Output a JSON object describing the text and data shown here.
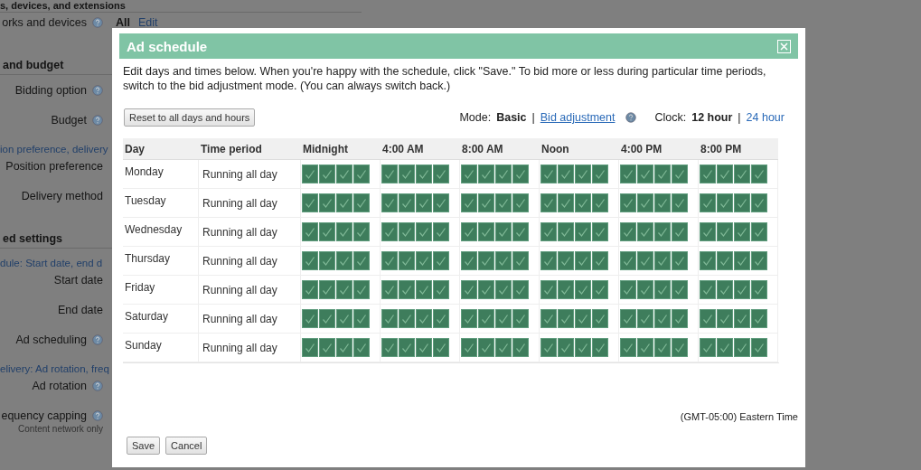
{
  "background": {
    "items": [
      {
        "kind": "heading",
        "text": "s, devices, and extensions"
      },
      {
        "kind": "field",
        "label": "orks and devices",
        "help": true,
        "value": "All",
        "link": "Edit"
      },
      {
        "kind": "heading",
        "text": "and budget"
      },
      {
        "kind": "field",
        "label": "Bidding option",
        "help": true
      },
      {
        "kind": "field",
        "label": "Budget",
        "help": true
      },
      {
        "kind": "link",
        "text": "ion preference, delivery"
      },
      {
        "kind": "field",
        "label": "Position preference",
        "help": false
      },
      {
        "kind": "field",
        "label": "Delivery method",
        "help": false
      },
      {
        "kind": "heading",
        "text": "ed settings"
      },
      {
        "kind": "link",
        "text": "dule: Start date, end d"
      },
      {
        "kind": "field",
        "label": "Start date",
        "help": false
      },
      {
        "kind": "field",
        "label": "End date",
        "help": false
      },
      {
        "kind": "field",
        "label": "Ad scheduling",
        "help": true
      },
      {
        "kind": "link",
        "text": "elivery: Ad rotation, freq"
      },
      {
        "kind": "field",
        "label": "Ad rotation",
        "help": true
      },
      {
        "kind": "field",
        "label": "equency capping",
        "help": true,
        "note": "Content network only"
      }
    ]
  },
  "dialog": {
    "title": "Ad schedule",
    "intro": "Edit days and times below. When you're happy with the schedule, click \"Save.\" To bid more or less during particular time periods, switch to the bid adjustment mode. (You can always switch back.)",
    "reset_button": "Reset to all days and hours",
    "mode_label": "Mode:",
    "modes": [
      {
        "label": "Basic",
        "selected": true
      },
      {
        "label": "Bid adjustment",
        "selected": false
      }
    ],
    "separator": "|",
    "clock_label": "Clock:",
    "clocks": [
      {
        "label": "12 hour",
        "selected": true
      },
      {
        "label": "24 hour",
        "selected": false
      }
    ],
    "columns": [
      "Day",
      "Time period",
      "Midnight",
      "4:00 AM",
      "8:00 AM",
      "Noon",
      "4:00 PM",
      "8:00 PM"
    ],
    "rows": [
      {
        "day": "Monday",
        "period": "Running all day",
        "hours": [
          true,
          true,
          true,
          true,
          true,
          true,
          true,
          true,
          true,
          true,
          true,
          true,
          true,
          true,
          true,
          true,
          true,
          true,
          true,
          true,
          true,
          true,
          true,
          true
        ]
      },
      {
        "day": "Tuesday",
        "period": "Running all day",
        "hours": [
          true,
          true,
          true,
          true,
          true,
          true,
          true,
          true,
          true,
          true,
          true,
          true,
          true,
          true,
          true,
          true,
          true,
          true,
          true,
          true,
          true,
          true,
          true,
          true
        ]
      },
      {
        "day": "Wednesday",
        "period": "Running all day",
        "hours": [
          true,
          true,
          true,
          true,
          true,
          true,
          true,
          true,
          true,
          true,
          true,
          true,
          true,
          true,
          true,
          true,
          true,
          true,
          true,
          true,
          true,
          true,
          true,
          true
        ]
      },
      {
        "day": "Thursday",
        "period": "Running all day",
        "hours": [
          true,
          true,
          true,
          true,
          true,
          true,
          true,
          true,
          true,
          true,
          true,
          true,
          true,
          true,
          true,
          true,
          true,
          true,
          true,
          true,
          true,
          true,
          true,
          true
        ]
      },
      {
        "day": "Friday",
        "period": "Running all day",
        "hours": [
          true,
          true,
          true,
          true,
          true,
          true,
          true,
          true,
          true,
          true,
          true,
          true,
          true,
          true,
          true,
          true,
          true,
          true,
          true,
          true,
          true,
          true,
          true,
          true
        ]
      },
      {
        "day": "Saturday",
        "period": "Running all day",
        "hours": [
          true,
          true,
          true,
          true,
          true,
          true,
          true,
          true,
          true,
          true,
          true,
          true,
          true,
          true,
          true,
          true,
          true,
          true,
          true,
          true,
          true,
          true,
          true,
          true
        ]
      },
      {
        "day": "Sunday",
        "period": "Running all day",
        "hours": [
          true,
          true,
          true,
          true,
          true,
          true,
          true,
          true,
          true,
          true,
          true,
          true,
          true,
          true,
          true,
          true,
          true,
          true,
          true,
          true,
          true,
          true,
          true,
          true
        ]
      }
    ],
    "timezone": "(GMT-05:00) Eastern Time",
    "buttons": [
      "Save",
      "Cancel"
    ]
  }
}
